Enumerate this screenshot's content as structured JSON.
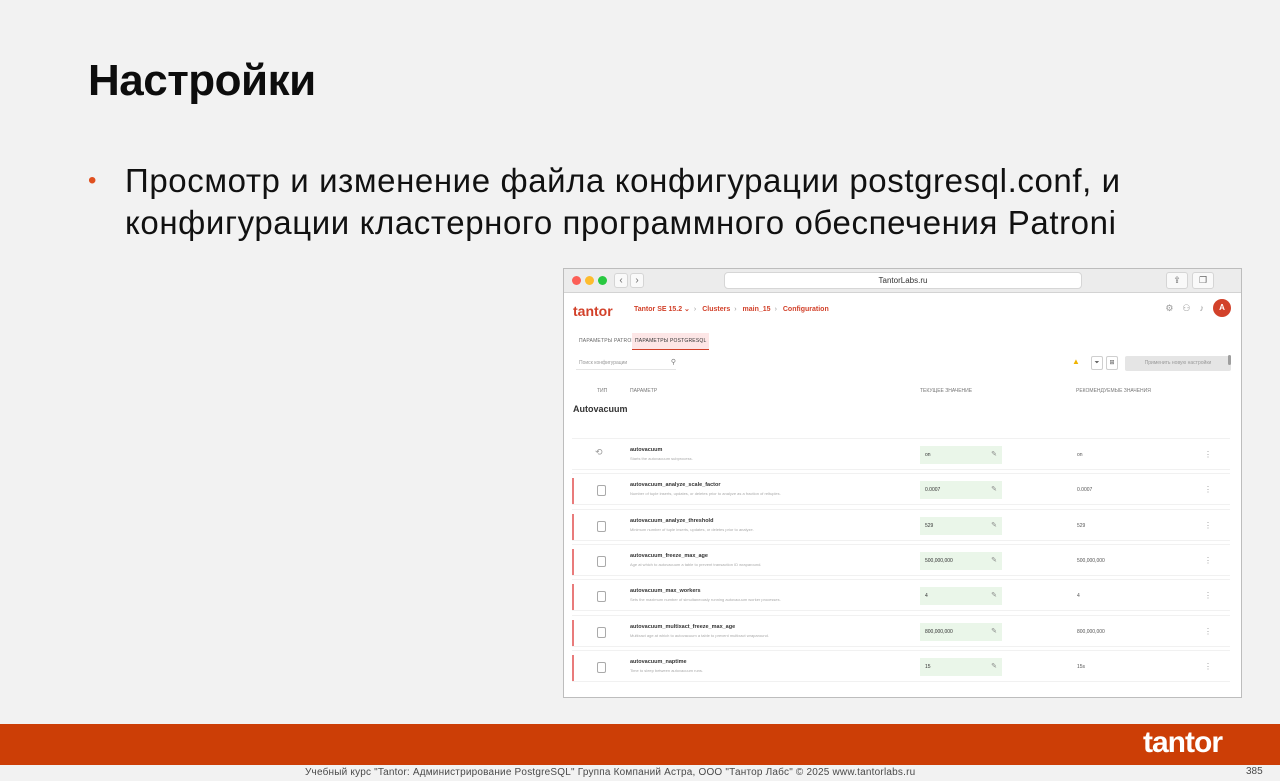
{
  "slide": {
    "title": "Настройки",
    "bullet": "Просмотр и изменение файла конфигурации postgresql.conf, и конфигурации кластерного программного обеспечения Patroni"
  },
  "browser": {
    "url": "TantorLabs.ru",
    "back": "‹",
    "forward": "›",
    "share_icon": "share-icon",
    "tabs_icon": "tabs-icon"
  },
  "app": {
    "logo": "tantor",
    "breadcrumbs": [
      "Tantor SE 15.2 ⌄",
      "Clusters",
      "main_15",
      "Configuration"
    ],
    "avatar": "A",
    "tabs": [
      "ПАРАМЕТРЫ PATRONI",
      "ПАРАМЕТРЫ POSTGRESQL"
    ],
    "search_placeholder": "Поиск конфигурации",
    "apply_button": "Применить новую настройки",
    "columns": [
      "ТИП",
      "ПАРАМЕТР",
      "ТЕКУЩЕЕ ЗНАЧЕНИЕ",
      "РЕКОМЕНДУЕМЫЕ ЗНАЧЕНИЯ"
    ],
    "section": "Autovacuum",
    "rows": [
      {
        "name": "autovacuum",
        "desc": "Starts the autovacuum subprocess.",
        "current": "on",
        "recommended": "on",
        "marked": false
      },
      {
        "name": "autovacuum_analyze_scale_factor",
        "desc": "Number of tuple inserts, updates, or deletes prior to analyze as a fraction of reltuples.",
        "current": "0.0007",
        "recommended": "0.0007",
        "marked": true
      },
      {
        "name": "autovacuum_analyze_threshold",
        "desc": "Minimum number of tuple inserts, updates, or deletes prior to analyze.",
        "current": "529",
        "recommended": "529",
        "marked": true
      },
      {
        "name": "autovacuum_freeze_max_age",
        "desc": "Age at which to autovacuum a table to prevent transaction ID wraparound.",
        "current": "500,000,000",
        "recommended": "500,000,000",
        "marked": true
      },
      {
        "name": "autovacuum_max_workers",
        "desc": "Sets the maximum number of simultaneously running autovacuum worker processes.",
        "current": "4",
        "recommended": "4",
        "marked": true
      },
      {
        "name": "autovacuum_multixact_freeze_max_age",
        "desc": "Multixact age at which to autovacuum a table to prevent multixact wraparound.",
        "current": "800,000,000",
        "recommended": "800,000,000",
        "marked": true
      },
      {
        "name": "autovacuum_naptime",
        "desc": "Time to sleep between autovacuum runs.",
        "current": "15",
        "recommended": "15s",
        "marked": true
      }
    ]
  },
  "footer": {
    "brand": "tantor",
    "credit": "Учебный курс \"Tantor: Администрирование PostgreSQL\" Группа Компаний Астра, ООО \"Тантор Лабс\" © 2025  www.tantorlabs.ru",
    "page": "385"
  },
  "colors": {
    "accent": "#cc3e06",
    "brand_red": "#d2412a",
    "bullet": "#e0501f",
    "row_marker": "#e97b7b",
    "value_bg": "#eaf6e9"
  }
}
